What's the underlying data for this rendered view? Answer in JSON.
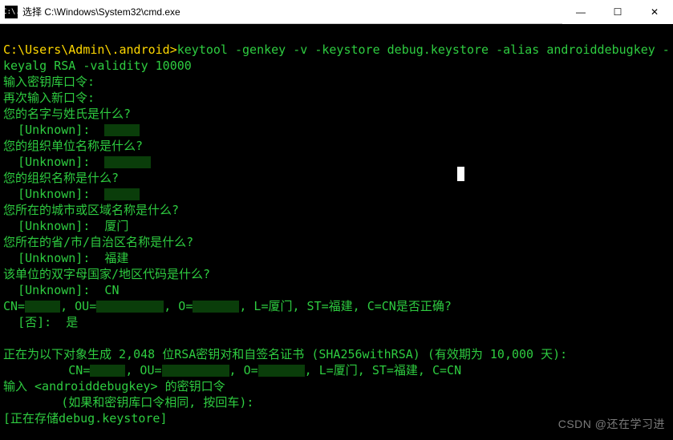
{
  "window": {
    "title": "选择 C:\\Windows\\System32\\cmd.exe",
    "icon_label": "C:\\."
  },
  "controls": {
    "min": "—",
    "max": "☐",
    "close": "✕"
  },
  "prompt": {
    "path": "C:\\Users\\Admin\\.android>",
    "command": "keytool -genkey -v -keystore debug.keystore -alias androiddebugkey -keyalg RSA -validity 10000"
  },
  "lines": {
    "l1": "输入密钥库口令:",
    "l2": "再次输入新口令:",
    "q1": "您的名字与姓氏是什么?",
    "u1": "  [Unknown]:  ",
    "q2": "您的组织单位名称是什么?",
    "u2": "  [Unknown]:  ",
    "q3": "您的组织名称是什么?",
    "u3": "  [Unknown]:  ",
    "q4": "您所在的城市或区域名称是什么?",
    "u4": "  [Unknown]:  厦门",
    "q5": "您所在的省/市/自治区名称是什么?",
    "u5": "  [Unknown]:  福建",
    "q6": "该单位的双字母国家/地区代码是什么?",
    "u6": "  [Unknown]:  CN",
    "dn_pre": "CN=",
    "dn_ou": ", OU=",
    "dn_o": ", O=",
    "dn_rest": ", L=厦门, ST=福建, C=CN是否正确?",
    "confirm": "  [否]:  是",
    "gen1": "正在为以下对象生成 2,048 位RSA密钥对和自签名证书 (SHA256withRSA) (有效期为 10,000 天):",
    "gen2_pre": "         CN=",
    "gen2_ou": ", OU=",
    "gen2_o": ", O=",
    "gen2_rest": ", L=厦门, ST=福建, C=CN",
    "pass1": "输入 <androiddebugkey> 的密钥口令",
    "pass2": "        (如果和密钥库口令相同, 按回车):",
    "store": "[正在存储debug.keystore]"
  },
  "watermark": "CSDN @还在学习进"
}
